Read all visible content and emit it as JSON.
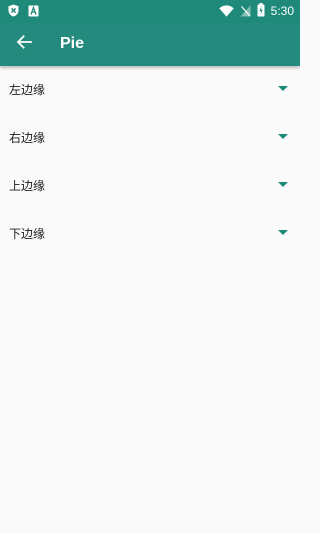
{
  "status_bar": {
    "time": "5:30",
    "left_icons": [
      "shield-notification-icon",
      "font-a-notification-icon"
    ],
    "right_icons": [
      "wifi-icon",
      "no-signal-icon",
      "battery-charging-icon"
    ]
  },
  "app_bar": {
    "title": "Pie",
    "back_icon": "arrow-back-icon"
  },
  "settings": [
    {
      "label": "左边缘"
    },
    {
      "label": "右边缘"
    },
    {
      "label": "上边缘"
    },
    {
      "label": "下边缘"
    }
  ],
  "colors": {
    "primary": "#238a7d",
    "status_bar": "#1f8a7a",
    "background": "#fafafa",
    "accent": "#1f8a7a"
  }
}
